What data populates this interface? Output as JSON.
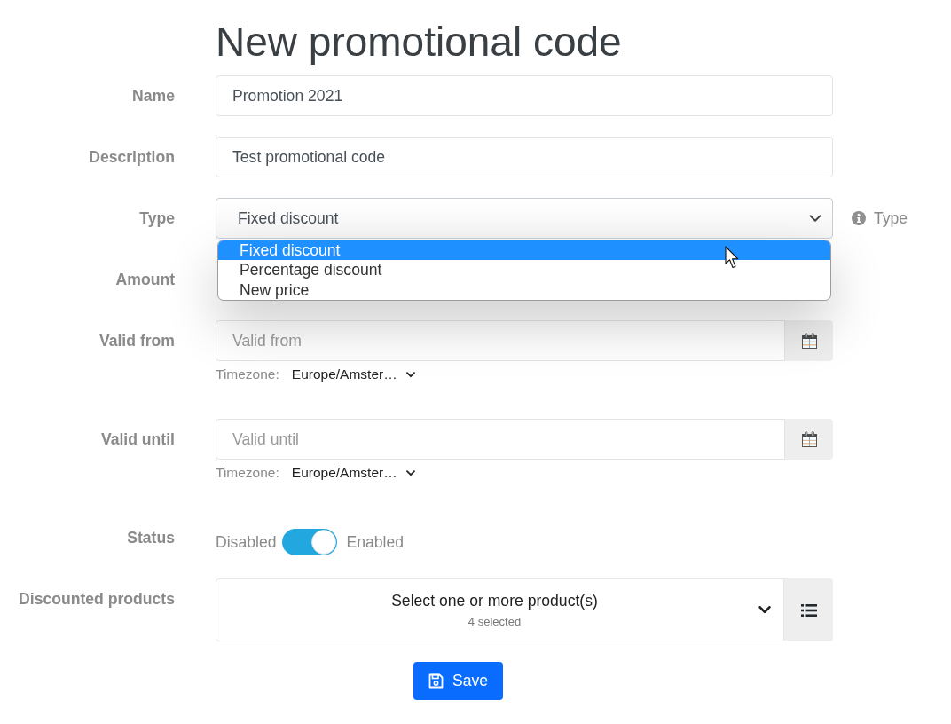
{
  "title": "New promotional code",
  "fields": [
    {
      "kind": "text",
      "label": "Name",
      "value": "Promotion 2021"
    },
    {
      "kind": "text",
      "label": "Description",
      "value": "Test promotional code"
    },
    {
      "kind": "select",
      "label": "Type",
      "value": "Fixed discount",
      "expanded": true,
      "help": "Type",
      "options": [
        {
          "label": "Fixed discount",
          "selected": true
        },
        {
          "label": "Percentage discount",
          "selected": false
        },
        {
          "label": "New price",
          "selected": false
        }
      ]
    },
    {
      "kind": "number",
      "label": "Amount"
    },
    {
      "kind": "date",
      "label": "Valid from",
      "placeholder": "Valid from",
      "timezone_label": "Timezone:",
      "timezone": "Europe/Amster…"
    },
    {
      "kind": "date",
      "label": "Valid until",
      "placeholder": "Valid until",
      "timezone_label": "Timezone:",
      "timezone": "Europe/Amster…"
    },
    {
      "kind": "toggle",
      "label": "Status",
      "off_label": "Disabled",
      "on_label": "Enabled",
      "on": true
    },
    {
      "kind": "multiselect",
      "label": "Discounted products",
      "placeholder": "Select one or more product(s)",
      "count": "4 selected"
    }
  ],
  "save_button": {
    "label": "Save"
  }
}
